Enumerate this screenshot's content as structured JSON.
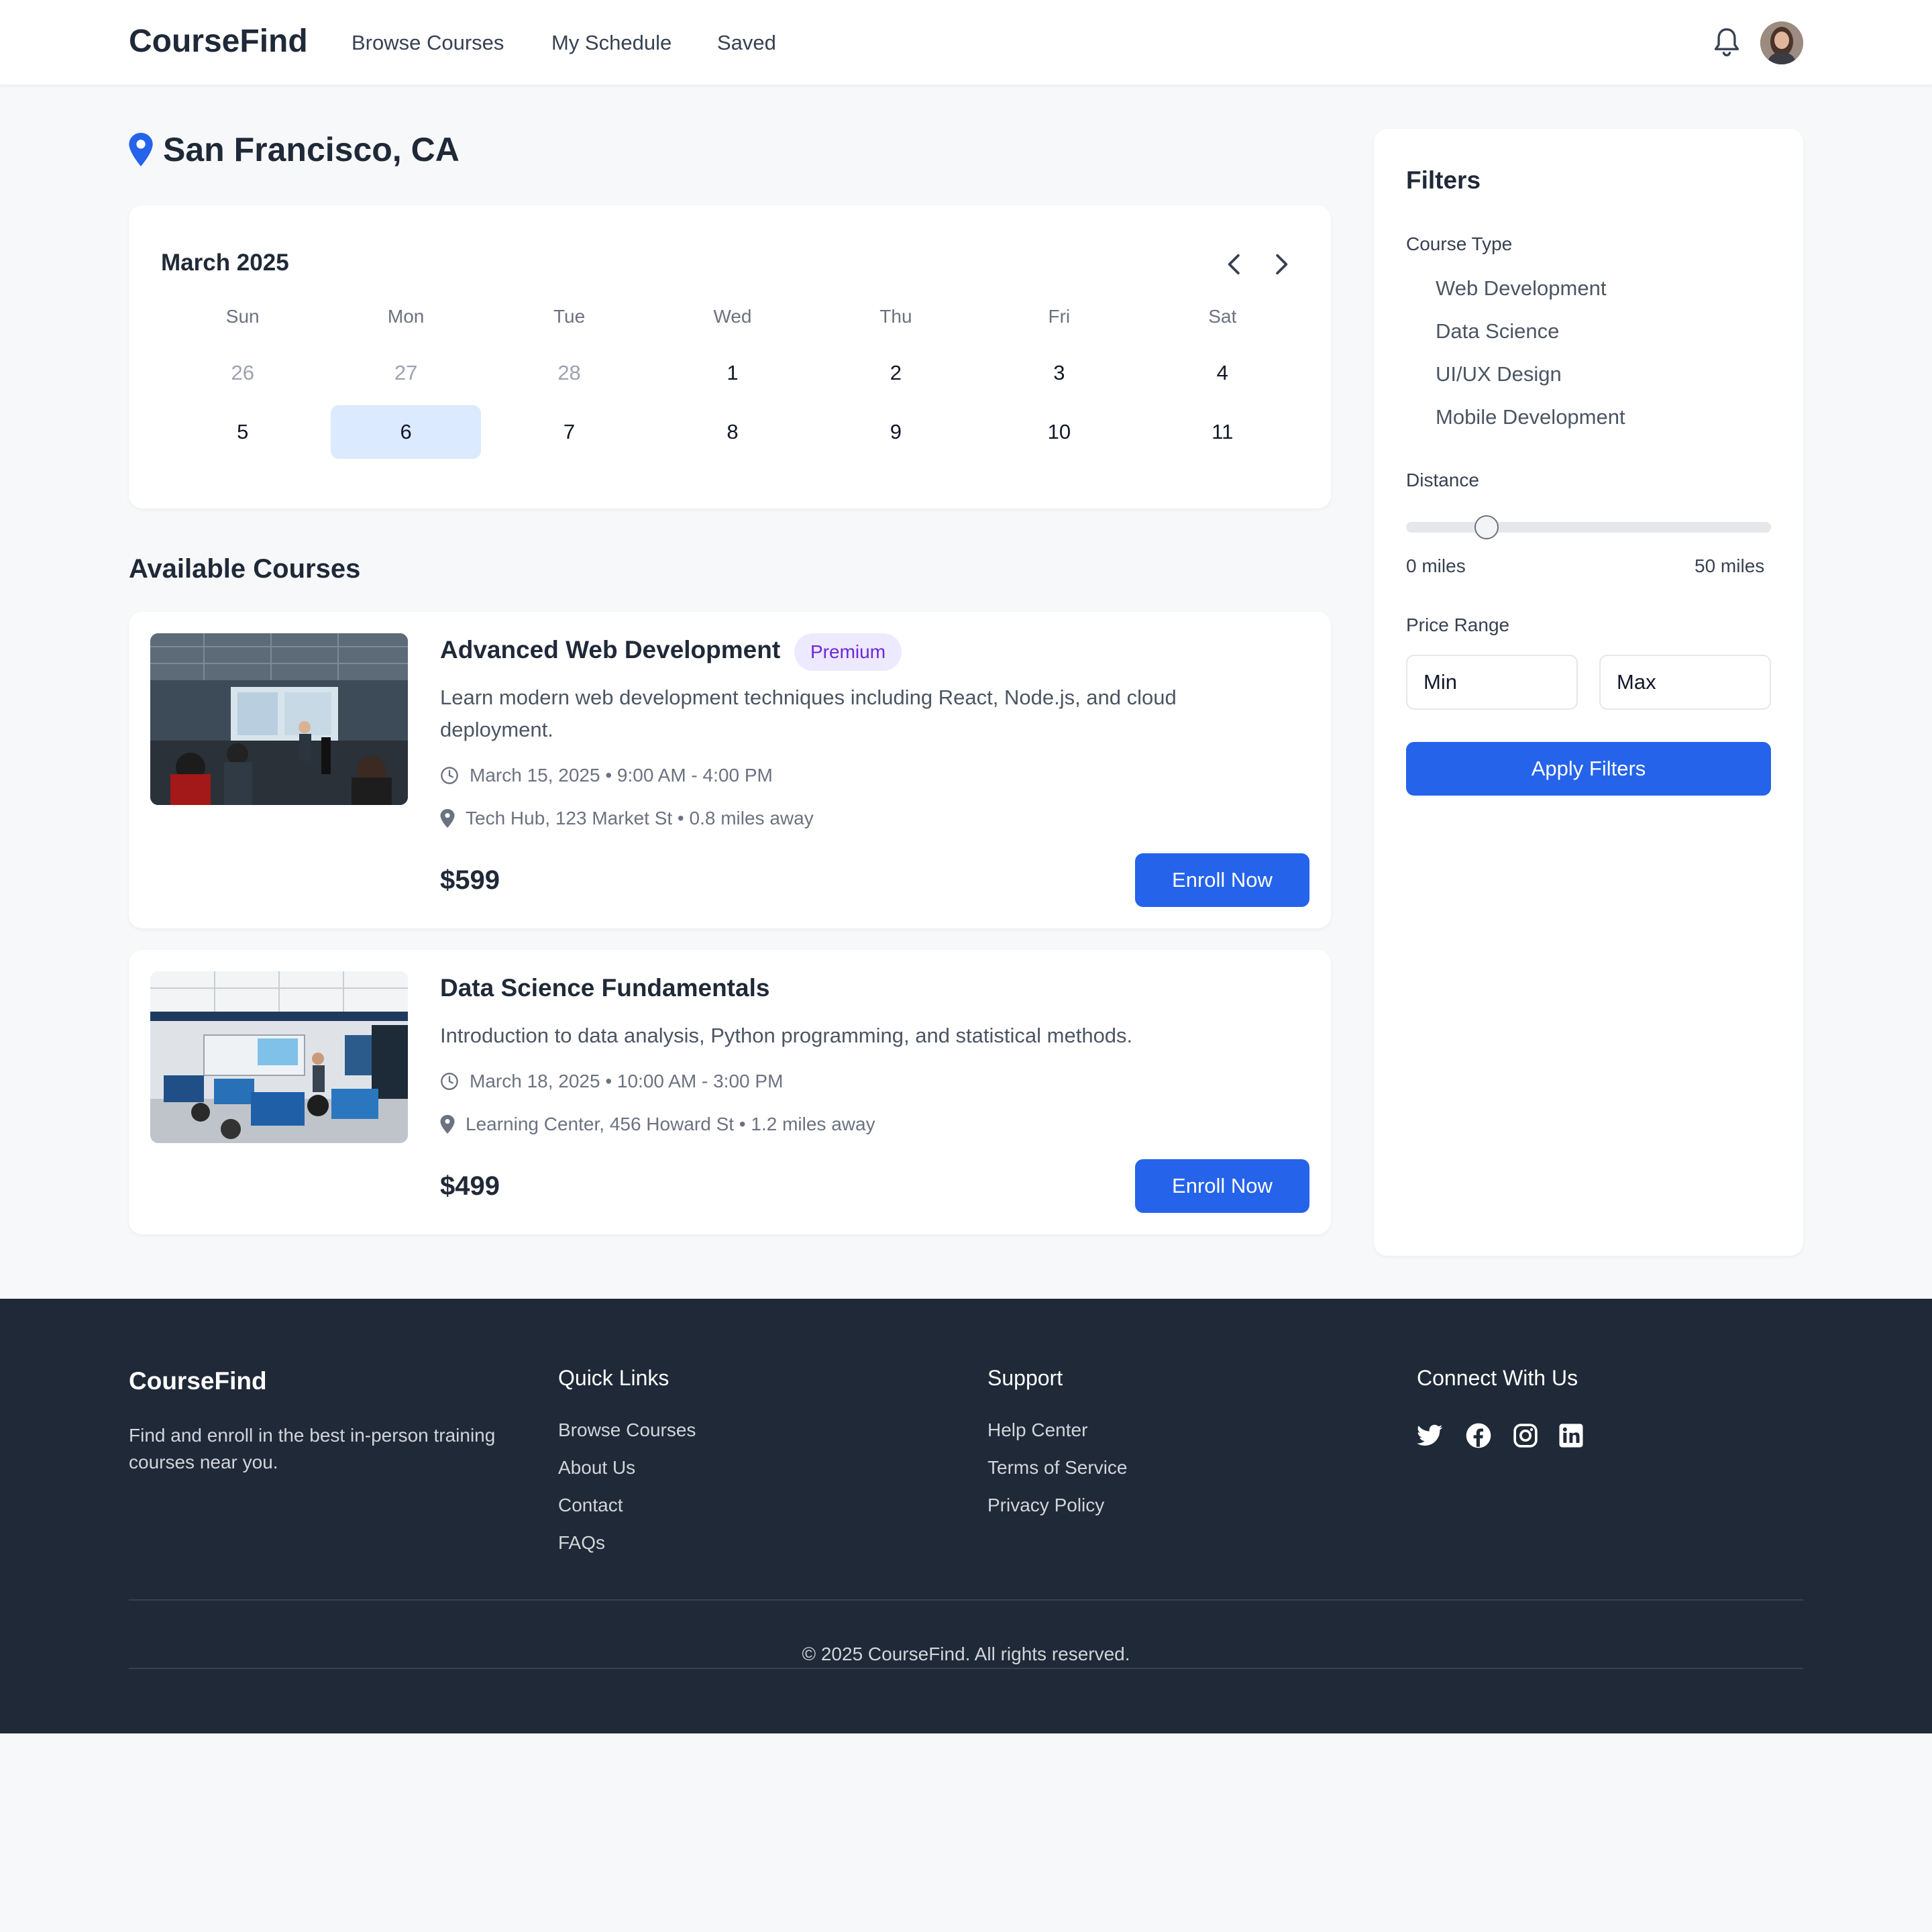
{
  "header": {
    "logo": "CourseFind",
    "nav": [
      "Browse Courses",
      "My Schedule",
      "Saved"
    ],
    "icons": [
      "bell-icon",
      "user-avatar"
    ]
  },
  "location": {
    "title": "San Francisco, CA",
    "icon": "map-pin-icon"
  },
  "calendar": {
    "month": "March 2025",
    "weekdays": [
      "Sun",
      "Mon",
      "Tue",
      "Wed",
      "Thu",
      "Fri",
      "Sat"
    ],
    "weeks": [
      [
        "26",
        "27",
        "28",
        "1",
        "2",
        "3",
        "4"
      ],
      [
        "5",
        "6",
        "7",
        "8",
        "9",
        "10",
        "11"
      ]
    ],
    "selected": "6",
    "colors": {
      "selected_bg": "#dbeafe"
    }
  },
  "courses_section": {
    "title": "Available Courses",
    "courses": [
      {
        "title": "Advanced Web Development",
        "badge": "Premium",
        "description": "Learn modern web development techniques including React, Node.js, and cloud deployment.",
        "date": "March 15, 2025 • 9:00 AM - 4:00 PM",
        "location": "Tech Hub, 123 Market St • 0.8 miles away",
        "price": "$599",
        "cta": "Enroll Now"
      },
      {
        "title": "Data Science Fundamentals",
        "description": "Introduction to data analysis, Python programming, and statistical methods.",
        "date": "March 18, 2025 • 10:00 AM - 3:00 PM",
        "location": "Learning Center, 456 Howard St • 1.2 miles away",
        "price": "$499",
        "cta": "Enroll Now"
      }
    ]
  },
  "filters": {
    "title": "Filters",
    "course_type_label": "Course Type",
    "course_types": [
      "Web Development",
      "Data Science",
      "UI/UX Design",
      "Mobile Development"
    ],
    "distance_label": "Distance",
    "distance_min": "0 miles",
    "distance_max": "50 miles",
    "distance_value_fraction": 0.22,
    "price_label": "Price Range",
    "price_min_placeholder": "Min",
    "price_max_placeholder": "Max",
    "apply_label": "Apply Filters"
  },
  "footer": {
    "brand": "CourseFind",
    "about": "Find and enroll in the best in-person training courses near you.",
    "quick_links_title": "Quick Links",
    "quick_links": [
      "Browse Courses",
      "About Us",
      "Contact",
      "FAQs"
    ],
    "support_title": "Support",
    "support_links": [
      "Help Center",
      "Terms of Service",
      "Privacy Policy"
    ],
    "connect_title": "Connect With Us",
    "social_icons": [
      "twitter-icon",
      "facebook-icon",
      "instagram-icon",
      "linkedin-icon"
    ],
    "copyright": "© 2025 CourseFind. All rights reserved."
  },
  "colors": {
    "primary": "#2563eb",
    "footer_bg": "#1f2937",
    "badge_bg": "#ede9fe",
    "badge_text": "#6d28d9"
  }
}
